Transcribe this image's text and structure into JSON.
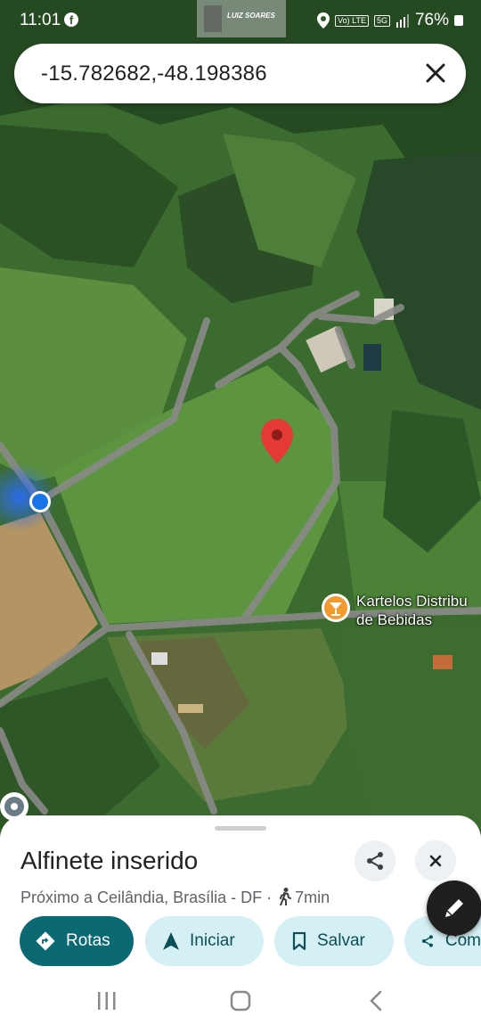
{
  "status_bar": {
    "time": "11:01",
    "network": "5G",
    "volte": "Vo) LTE",
    "battery": "76%"
  },
  "watermark": {
    "text": "LUIZ SOARES"
  },
  "search": {
    "query": "-15.782682,-48.198386"
  },
  "map": {
    "poi_label_line1": "Kartelos Distribu",
    "poi_label_line2": "de Bebidas",
    "poi_icon": "bar-cocktail-icon",
    "pin_color": "#e53935",
    "location_dot_color": "#1a73e8"
  },
  "place_sheet": {
    "title": "Alfinete inserido",
    "location": "Próximo a Ceilândia, Brasília - DF ·",
    "walk_time": "7min",
    "actions": [
      {
        "label": "Rotas",
        "icon": "directions-icon"
      },
      {
        "label": "Iniciar",
        "icon": "navigation-arrow-icon"
      },
      {
        "label": "Salvar",
        "icon": "bookmark-icon"
      },
      {
        "label": "Com",
        "icon": "share-icon"
      }
    ]
  },
  "colors": {
    "primary_chip": "#0b6974",
    "secondary_chip": "#d5f0f4"
  }
}
